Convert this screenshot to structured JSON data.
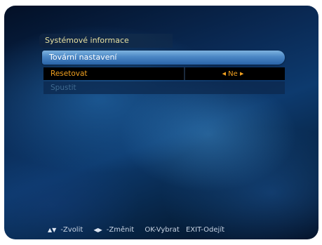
{
  "window": {
    "title": "Systémové informace"
  },
  "panel": {
    "title": "Tovární nastavení"
  },
  "menu": {
    "items": [
      {
        "label": "Resetovat",
        "value": "Ne",
        "selected": true
      },
      {
        "label": "Spustit",
        "value": "",
        "selected": false
      }
    ]
  },
  "footer": {
    "navigate": "-Zvolit",
    "change": "-Změnit",
    "ok": "OK-Vybrat",
    "exit": "EXIT-Odejít"
  },
  "colors": {
    "selected_text": "#f0a020",
    "header_bg": "#4a86c4",
    "disabled_text": "#3f6a90"
  }
}
